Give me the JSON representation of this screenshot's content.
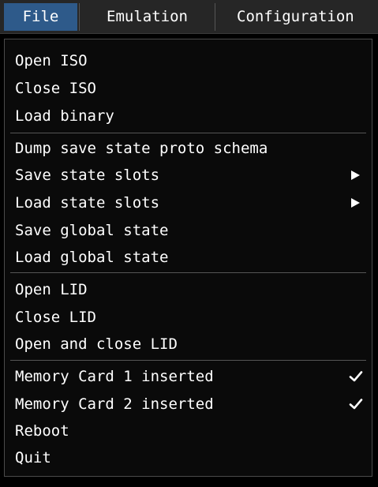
{
  "menubar": {
    "file": "File",
    "emulation": "Emulation",
    "configuration": "Configuration"
  },
  "file_menu": {
    "open_iso": "Open ISO",
    "close_iso": "Close ISO",
    "load_binary": "Load binary",
    "dump_schema": "Dump save state proto schema",
    "save_state_slots": "Save state slots",
    "load_state_slots": "Load state slots",
    "save_global_state": "Save global state",
    "load_global_state": "Load global state",
    "open_lid": "Open LID",
    "close_lid": "Close LID",
    "open_and_close_lid": "Open and close LID",
    "memory_card_1": "Memory Card 1 inserted",
    "memory_card_2": "Memory Card 2 inserted",
    "reboot": "Reboot",
    "quit": "Quit",
    "memory_card_1_checked": true,
    "memory_card_2_checked": true
  },
  "icons": {
    "submenu": "chevron-right-icon",
    "checked": "checkmark-icon"
  },
  "colors": {
    "menubar_bg": "#262626",
    "active_menu_bg": "#2e5a8a",
    "dropdown_bg": "#0a0a0a",
    "text": "#ffffff",
    "separator": "#555555"
  }
}
